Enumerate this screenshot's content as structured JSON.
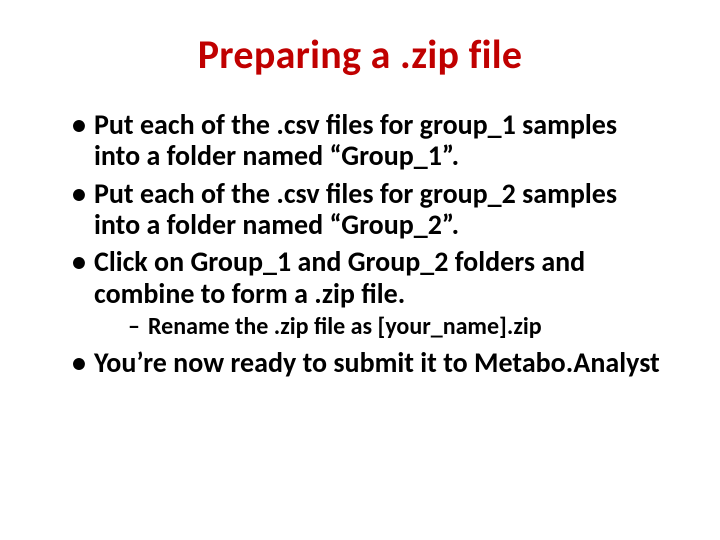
{
  "title": "Preparing a .zip file",
  "bullets": [
    {
      "text": "Put each of the .csv files for group_1 samples into a folder named “Group_1”."
    },
    {
      "text": "Put each of the .csv files for group_2 samples into a folder named “Group_2”."
    },
    {
      "text": "Click on Group_1 and Group_2 folders and combine to form a .zip file.",
      "sub": [
        {
          "text": "Rename the .zip file as [your_name].zip"
        }
      ]
    },
    {
      "text": "You’re now ready to submit it to Metabo.Analyst"
    }
  ]
}
